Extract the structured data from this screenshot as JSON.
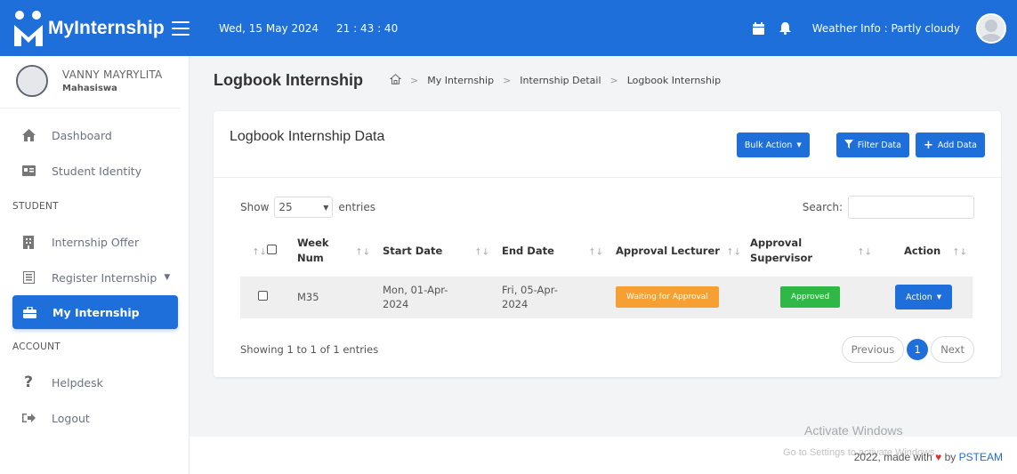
{
  "app": {
    "brand": "MyInternship"
  },
  "topbar": {
    "date": "Wed, 15 May 2024",
    "time": "21 : 43 : 40",
    "weather": "Weather Info : Partly cloudy"
  },
  "profile": {
    "name": "VANNY MAYRYLITA",
    "role": "Mahasiswa"
  },
  "sidebar": {
    "items": [
      {
        "label": "Dashboard",
        "icon": "home-icon"
      },
      {
        "label": "Student Identity",
        "icon": "id-card-icon"
      }
    ],
    "section_student": "STUDENT",
    "student_items": [
      {
        "label": "Internship Offer",
        "icon": "building-icon"
      },
      {
        "label": "Register Internship",
        "icon": "form-icon"
      },
      {
        "label": "My Internship",
        "icon": "briefcase-icon",
        "active": true
      }
    ],
    "section_account": "ACCOUNT",
    "account_items": [
      {
        "label": "Helpdesk",
        "icon": "question-icon"
      },
      {
        "label": "Logout",
        "icon": "logout-icon"
      }
    ]
  },
  "page": {
    "title": "Logbook Internship",
    "breadcrumb": [
      "My Internship",
      "Internship Detail",
      "Logbook Internship"
    ]
  },
  "card": {
    "title": "Logbook Internship Data",
    "bulk_action": "Bulk Action",
    "filter": "Filter Data",
    "add": "Add Data"
  },
  "table_controls": {
    "show": "Show",
    "entries_value": "25",
    "entries": "entries",
    "search": "Search:",
    "search_value": ""
  },
  "table": {
    "headers": [
      "Week Num",
      "Start Date",
      "End Date",
      "Approval Lecturer",
      "Approval Supervisor",
      "Action"
    ],
    "rows": [
      {
        "week": "M35",
        "start": "Mon, 01-Apr-2024",
        "end": "Fri, 05-Apr-2024",
        "lecturer": "Waiting for Approval",
        "supervisor": "Approved",
        "action": "Action"
      }
    ]
  },
  "pagination": {
    "info": "Showing 1 to 1 of 1 entries",
    "previous": "Previous",
    "page": "1",
    "next": "Next"
  },
  "footer": {
    "watermark": "Activate Windows",
    "watermark_sub": "Go to Settings to activate Windows.",
    "copyright_prefix": "2022, made with",
    "copyright_by": "by",
    "team": "PSTEAM"
  },
  "colors": {
    "primary": "#1e6fd9",
    "warning": "#f6a034",
    "success": "#2fb845"
  }
}
